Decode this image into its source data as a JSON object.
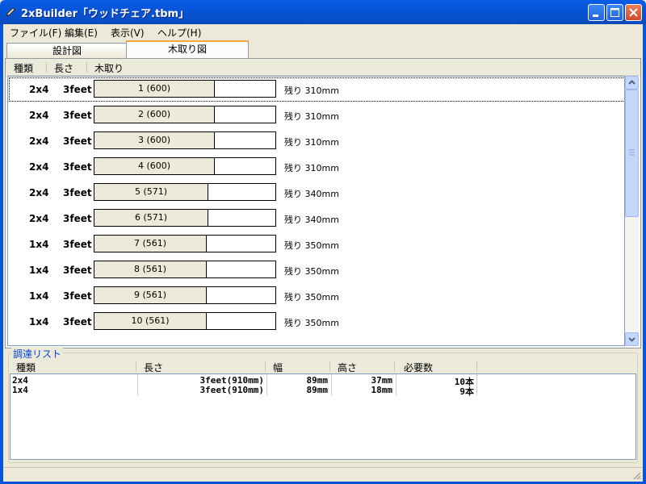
{
  "window": {
    "title": "2xBuilder「ウッドチェア.tbm」",
    "app_icon": "pencil-icon",
    "controls": [
      "minimize-icon",
      "maximize-icon",
      "close-icon"
    ]
  },
  "menu": {
    "items": [
      "ファイル(F)",
      "編集(E)",
      "表示(V)",
      "ヘルプ(H)"
    ]
  },
  "tabs": [
    {
      "label": "設計図",
      "active": false
    },
    {
      "label": "木取り図",
      "active": true
    }
  ],
  "cutlist": {
    "headers": [
      "種類",
      "長さ",
      "木取り"
    ],
    "rows": [
      {
        "kind": "2x4",
        "length": "3feet",
        "piece": "1 (600)",
        "fill": 0.659,
        "remaining": "残り 310mm",
        "selected": true
      },
      {
        "kind": "2x4",
        "length": "3feet",
        "piece": "2 (600)",
        "fill": 0.659,
        "remaining": "残り 310mm"
      },
      {
        "kind": "2x4",
        "length": "3feet",
        "piece": "3 (600)",
        "fill": 0.659,
        "remaining": "残り 310mm"
      },
      {
        "kind": "2x4",
        "length": "3feet",
        "piece": "4 (600)",
        "fill": 0.659,
        "remaining": "残り 310mm"
      },
      {
        "kind": "2x4",
        "length": "3feet",
        "piece": "5 (571)",
        "fill": 0.627,
        "remaining": "残り 340mm"
      },
      {
        "kind": "2x4",
        "length": "3feet",
        "piece": "6 (571)",
        "fill": 0.627,
        "remaining": "残り 340mm"
      },
      {
        "kind": "1x4",
        "length": "3feet",
        "piece": "7 (561)",
        "fill": 0.616,
        "remaining": "残り 350mm"
      },
      {
        "kind": "1x4",
        "length": "3feet",
        "piece": "8 (561)",
        "fill": 0.616,
        "remaining": "残り 350mm"
      },
      {
        "kind": "1x4",
        "length": "3feet",
        "piece": "9 (561)",
        "fill": 0.616,
        "remaining": "残り 350mm"
      },
      {
        "kind": "1x4",
        "length": "3feet",
        "piece": "10 (561)",
        "fill": 0.616,
        "remaining": "残り 350mm"
      }
    ],
    "scroll_position": 0.0
  },
  "procurement": {
    "title": "調達リスト",
    "headers": [
      "種類",
      "長さ",
      "幅",
      "高さ",
      "必要数"
    ],
    "rows": [
      {
        "kind": "2x4",
        "length": "3feet(910mm)",
        "width": "89mm",
        "height": "37mm",
        "qty": "10本"
      },
      {
        "kind": "1x4",
        "length": "3feet(910mm)",
        "width": "89mm",
        "height": "18mm",
        "qty": "9本"
      }
    ]
  },
  "colors": {
    "titlebar": "#0754d8",
    "tab_highlight": "#f7a73c",
    "group_title": "#0046d5",
    "piece_fill": "#ece9d8"
  }
}
